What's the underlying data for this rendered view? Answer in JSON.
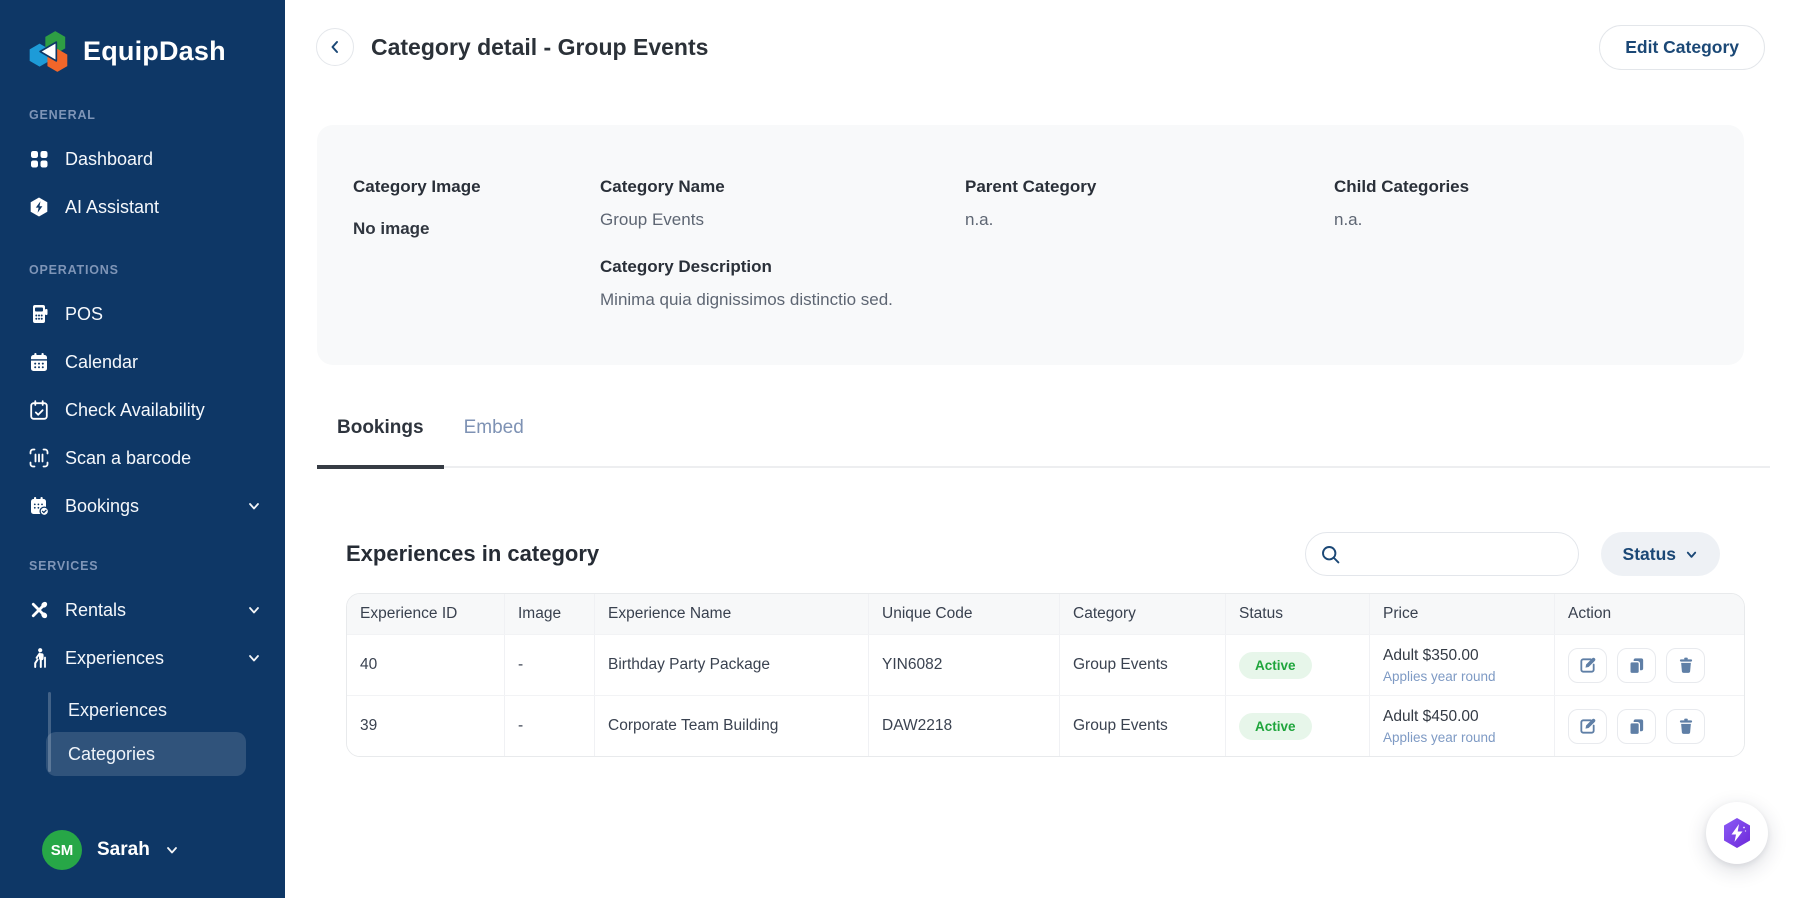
{
  "app": {
    "name": "EquipDash"
  },
  "sidebar": {
    "sections": [
      {
        "label": "GENERAL",
        "items": [
          {
            "label": "Dashboard"
          },
          {
            "label": "AI Assistant"
          }
        ]
      },
      {
        "label": "OPERATIONS",
        "items": [
          {
            "label": "POS"
          },
          {
            "label": "Calendar"
          },
          {
            "label": "Check Availability"
          },
          {
            "label": "Scan a barcode"
          },
          {
            "label": "Bookings",
            "has_submenu": true
          }
        ]
      },
      {
        "label": "SERVICES",
        "items": [
          {
            "label": "Rentals",
            "has_submenu": true
          },
          {
            "label": "Experiences",
            "has_submenu": true,
            "children": [
              {
                "label": "Experiences"
              },
              {
                "label": "Categories",
                "selected": true
              }
            ]
          }
        ]
      }
    ],
    "user": {
      "initials": "SM",
      "name": "Sarah"
    }
  },
  "header": {
    "title": "Category detail - Group Events",
    "edit_button_label": "Edit Category"
  },
  "detail_card": {
    "image_label": "Category Image",
    "image_value": "No image",
    "name_label": "Category Name",
    "name_value": "Group Events",
    "parent_label": "Parent Category",
    "parent_value": "n.a.",
    "children_label": "Child Categories",
    "children_value": "n.a.",
    "description_label": "Category Description",
    "description_value": "Minima quia dignissimos distinctio sed."
  },
  "tabs": {
    "bookings": "Bookings",
    "embed": "Embed",
    "active_tab": "Bookings"
  },
  "section": {
    "title": "Experiences in category",
    "search_placeholder": "",
    "status_filter_label": "Status"
  },
  "table": {
    "columns": [
      "Experience ID",
      "Image",
      "Experience Name",
      "Unique Code",
      "Category",
      "Status",
      "Price",
      "Action"
    ],
    "rows": [
      {
        "id": "40",
        "image": "-",
        "name": "Birthday Party Package",
        "code": "YIN6082",
        "category": "Group Events",
        "status": "Active",
        "price": "Adult $350.00",
        "price_note": "Applies year round"
      },
      {
        "id": "39",
        "image": "-",
        "name": "Corporate Team Building",
        "code": "DAW2218",
        "category": "Group Events",
        "status": "Active",
        "price": "Adult $450.00",
        "price_note": "Applies year round"
      }
    ]
  },
  "icons": {
    "logo": "equipdash-hexagons-logo",
    "sidebar": [
      "dashboard-grid-icon",
      "ai-assistant-hexagon-bolt-icon",
      "pos-terminal-icon",
      "calendar-icon",
      "calendar-check-icon",
      "barcode-scan-icon",
      "bookings-calendar-icon",
      "rentals-paddles-icon",
      "experiences-hiker-icon"
    ],
    "actions": [
      "edit-icon",
      "copy-icon",
      "trash-icon"
    ],
    "misc": [
      "back-chevron-icon",
      "search-icon",
      "chevron-down-icon",
      "lightning-hexagon-fab-icon"
    ]
  },
  "colors": {
    "sidebar_bg": "#0E3766",
    "accent_navy": "#1B4876",
    "active_badge_bg": "#E7F6EA",
    "active_badge_text": "#1FA53C",
    "avatar_bg": "#27A747",
    "fab_purple": "#7C3AED",
    "card_bg": "#F8F9FA"
  }
}
